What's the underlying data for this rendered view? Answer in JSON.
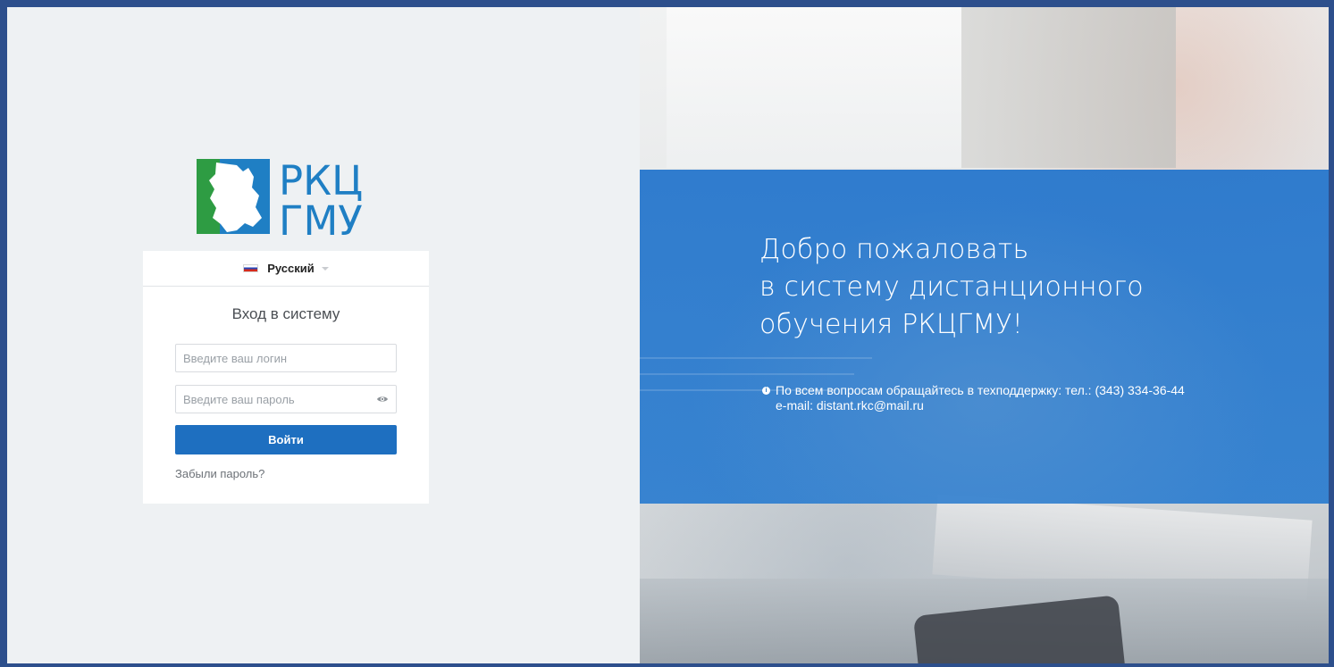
{
  "logo": {
    "line1": "РКЦ",
    "line2": "ГМУ",
    "colors": {
      "green": "#2e9c43",
      "blue": "#1f7fc4"
    }
  },
  "language": {
    "flag": "russia-flag",
    "label": "Русский"
  },
  "login_form": {
    "title": "Вход в систему",
    "login_placeholder": "Введите ваш логин",
    "password_placeholder": "Введите ваш пароль",
    "submit_label": "Войти",
    "forgot_link": "Забыли пароль?"
  },
  "welcome": {
    "title_lines": [
      "Добро пожаловать",
      "в систему дистанционного",
      "обучения РКЦГМУ!"
    ],
    "support_text": "По всем вопросам обращайтесь в техподдержку: тел.: (343) 334-36-44",
    "email_text": "e-mail: distant.rkc@mail.ru"
  },
  "colors": {
    "accent": "#1e6fc0",
    "frame": "#2d4f8c",
    "overlay": "#2676cc",
    "left_background": "#eef1f3"
  }
}
